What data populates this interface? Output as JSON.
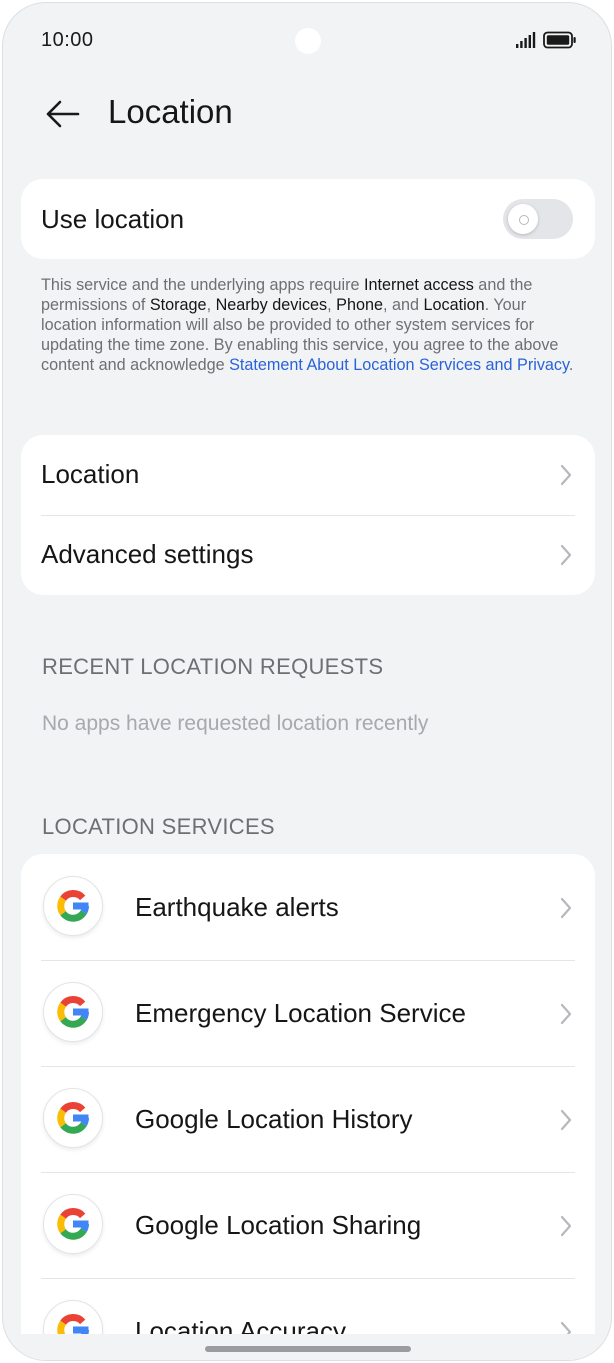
{
  "status_bar": {
    "time": "10:00"
  },
  "header": {
    "title": "Location"
  },
  "use_location": {
    "label": "Use location",
    "enabled": false
  },
  "notice": {
    "t1": "This service and the underlying apps require ",
    "b1": "Internet access",
    "t2": " and the permissions of ",
    "b2": "Storage",
    "t3": ", ",
    "b3": "Nearby devices",
    "t4": ", ",
    "b4": "Phone",
    "t5": ", and ",
    "b5": "Location",
    "t6": ". Your location information will also be provided to other system services for updating the time zone. By enabling this service, you agree to the above content and acknowledge ",
    "link": "Statement About Location Services and Privacy",
    "t7": "."
  },
  "settings": {
    "items": [
      {
        "label": "Location"
      },
      {
        "label": "Advanced settings"
      }
    ]
  },
  "recent_requests": {
    "header": "RECENT LOCATION REQUESTS",
    "empty_text": "No apps have requested location recently"
  },
  "location_services": {
    "header": "LOCATION SERVICES",
    "items": [
      {
        "label": "Earthquake alerts"
      },
      {
        "label": "Emergency Location Service"
      },
      {
        "label": "Google Location History"
      },
      {
        "label": "Google Location Sharing"
      },
      {
        "label": "Location Accuracy"
      }
    ]
  },
  "colors": {
    "accent_link": "#2a63d9",
    "background": "#f1f3f5",
    "card": "#ffffff"
  }
}
